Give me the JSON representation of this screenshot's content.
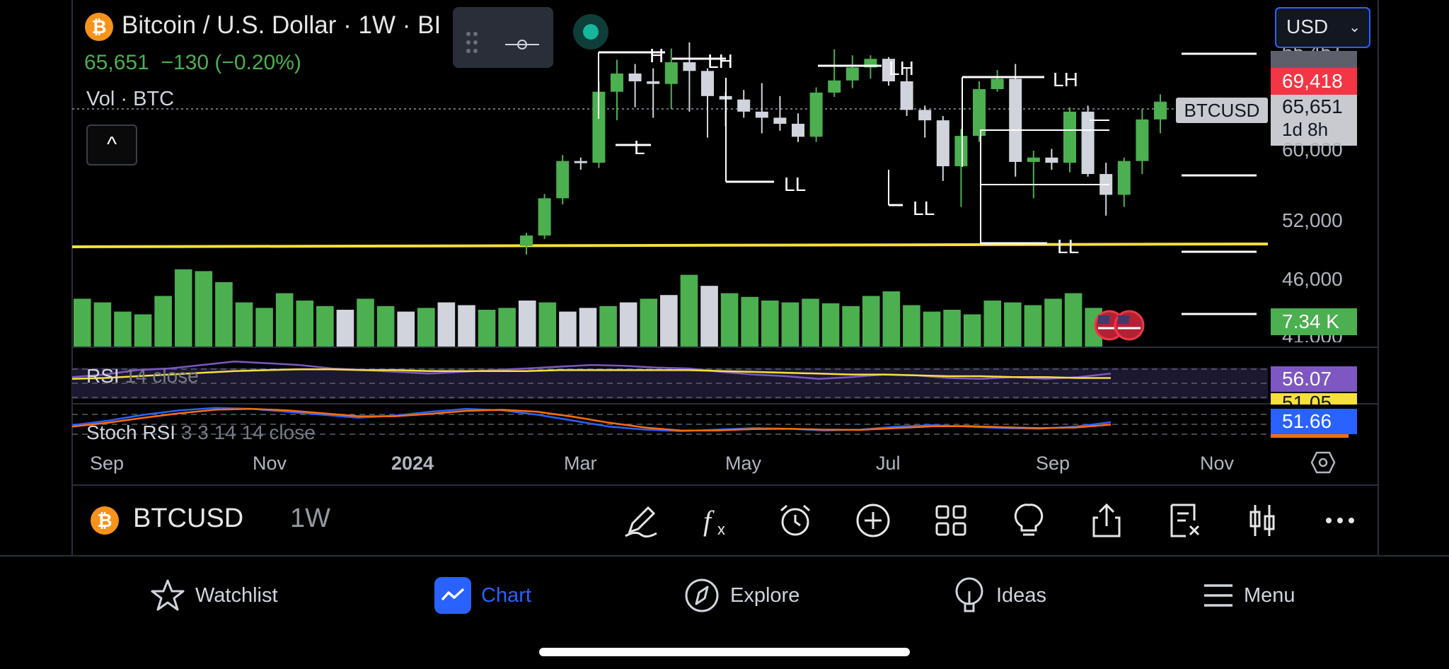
{
  "header": {
    "title": "Bitcoin / U.S. Dollar · 1W · BI",
    "coin_glyph": "₿",
    "price": "65,651",
    "change": "−130 (−0.20%)",
    "volume_label": "Vol · BTC",
    "collapse_glyph": "^"
  },
  "currency_select": {
    "value": "USD"
  },
  "price_axis": {
    "ticks": [
      "60,000",
      "52,000",
      "46,000",
      "41,000"
    ],
    "partial_top": "65,451"
  },
  "badges": {
    "high": {
      "label": "69,418",
      "color": "#f23645"
    },
    "last": {
      "symbol": "BTCUSD",
      "price": "65,651",
      "countdown": "1d 8h"
    },
    "volume": {
      "label": "7.34 K",
      "color": "#4caf50"
    },
    "rsi": {
      "label": "56.07",
      "color": "#7e57c2"
    },
    "rsi_ma": {
      "label": "51.05",
      "color": "#f7e03b"
    },
    "stoch": {
      "label": "51.66",
      "color": "#2962ff"
    }
  },
  "annotations": {
    "swing_labels": [
      "H",
      "L",
      "LH",
      "LL",
      "LH",
      "LL",
      "LH",
      "LL"
    ]
  },
  "indicators": {
    "rsi": {
      "name": "RSI",
      "params": "14 close"
    },
    "stoch": {
      "name": "Stoch RSI",
      "params": "3 3 14 14 close"
    }
  },
  "time_axis": {
    "ticks": [
      "Sep",
      "Nov",
      "2024",
      "Mar",
      "May",
      "Jul",
      "Sep",
      "Nov"
    ]
  },
  "toolbar": {
    "symbol": "BTCUSD",
    "timeframe": "1W",
    "tools": [
      "pencil-icon",
      "function-icon",
      "alarm-icon",
      "plus-circle-icon",
      "grid-icon",
      "lightbulb-icon",
      "share-icon",
      "note-icon",
      "candle-icon",
      "more-icon"
    ]
  },
  "bottom_nav": {
    "items": [
      {
        "label": "Watchlist",
        "icon": "star-icon"
      },
      {
        "label": "Chart",
        "icon": "chart-icon",
        "active": true
      },
      {
        "label": "Explore",
        "icon": "compass-icon"
      },
      {
        "label": "Ideas",
        "icon": "bulb-icon"
      },
      {
        "label": "Menu",
        "icon": "menu-icon"
      }
    ]
  },
  "colors": {
    "up": "#4caf50",
    "down": "#d1d4dc",
    "support_line": "#f7e03b",
    "accent": "#2962ff",
    "rsi_line": "#7e57c2",
    "stoch_k": "#2962ff",
    "stoch_d": "#ff6d00"
  },
  "chart_data": {
    "type": "candlestick",
    "interval": "1W",
    "price_axis_ticks": [
      41000,
      46000,
      52000,
      60000
    ],
    "support_level": 48900,
    "candles": [
      {
        "o": 49000,
        "h": 50500,
        "l": 48000,
        "c": 50200
      },
      {
        "o": 50200,
        "h": 55000,
        "l": 49800,
        "c": 54500
      },
      {
        "o": 54500,
        "h": 59500,
        "l": 53800,
        "c": 58800
      },
      {
        "o": 58800,
        "h": 59200,
        "l": 57800,
        "c": 58600
      },
      {
        "o": 58600,
        "h": 68000,
        "l": 58000,
        "c": 66800
      },
      {
        "o": 66800,
        "h": 70500,
        "l": 63500,
        "c": 68900
      },
      {
        "o": 68900,
        "h": 70000,
        "l": 65000,
        "c": 68000
      },
      {
        "o": 68000,
        "h": 69500,
        "l": 63800,
        "c": 67700
      },
      {
        "o": 67700,
        "h": 71800,
        "l": 64800,
        "c": 70200
      },
      {
        "o": 70200,
        "h": 72500,
        "l": 64500,
        "c": 69200
      },
      {
        "o": 69200,
        "h": 69500,
        "l": 61500,
        "c": 66300
      },
      {
        "o": 66300,
        "h": 66800,
        "l": 62800,
        "c": 65900
      },
      {
        "o": 65900,
        "h": 67000,
        "l": 63800,
        "c": 64500
      },
      {
        "o": 64500,
        "h": 67800,
        "l": 62000,
        "c": 63800
      },
      {
        "o": 63800,
        "h": 66300,
        "l": 62300,
        "c": 63100
      },
      {
        "o": 63100,
        "h": 64300,
        "l": 61000,
        "c": 61600
      },
      {
        "o": 61600,
        "h": 67300,
        "l": 61000,
        "c": 66700
      },
      {
        "o": 66700,
        "h": 71700,
        "l": 66200,
        "c": 68100
      },
      {
        "o": 68100,
        "h": 71000,
        "l": 67200,
        "c": 69600
      },
      {
        "o": 69600,
        "h": 71000,
        "l": 68300,
        "c": 70600
      },
      {
        "o": 70600,
        "h": 70800,
        "l": 67500,
        "c": 68000
      },
      {
        "o": 68000,
        "h": 69500,
        "l": 64000,
        "c": 64700
      },
      {
        "o": 64700,
        "h": 65200,
        "l": 61500,
        "c": 63500
      },
      {
        "o": 63500,
        "h": 64000,
        "l": 56500,
        "c": 58200
      },
      {
        "o": 58200,
        "h": 62500,
        "l": 53500,
        "c": 61700
      },
      {
        "o": 61700,
        "h": 68000,
        "l": 61000,
        "c": 67100
      },
      {
        "o": 67100,
        "h": 69300,
        "l": 66800,
        "c": 68300
      },
      {
        "o": 68300,
        "h": 70000,
        "l": 57000,
        "c": 58700
      },
      {
        "o": 58700,
        "h": 60000,
        "l": 54500,
        "c": 59200
      },
      {
        "o": 59200,
        "h": 60200,
        "l": 57800,
        "c": 58600
      },
      {
        "o": 58600,
        "h": 65000,
        "l": 57500,
        "c": 64500
      },
      {
        "o": 64500,
        "h": 65200,
        "l": 57000,
        "c": 57300
      },
      {
        "o": 57300,
        "h": 58600,
        "l": 52500,
        "c": 54900
      },
      {
        "o": 54900,
        "h": 59200,
        "l": 53500,
        "c": 58800
      },
      {
        "o": 58800,
        "h": 64800,
        "l": 57300,
        "c": 63600
      },
      {
        "o": 63600,
        "h": 66500,
        "l": 62000,
        "c": 65651
      }
    ],
    "volume_bars": [
      52,
      48,
      38,
      35,
      55,
      84,
      82,
      70,
      48,
      42,
      58,
      50,
      44,
      40,
      52,
      44,
      38,
      42,
      48,
      45,
      40,
      42,
      50,
      48,
      38,
      42,
      44,
      48,
      52,
      56,
      78,
      66,
      58,
      54,
      50,
      48,
      52,
      47,
      44,
      55,
      60,
      45,
      38,
      40,
      35,
      50,
      48,
      45,
      52,
      58,
      42
    ],
    "rsi": [
      52,
      55,
      60,
      62,
      66,
      70,
      68,
      66,
      62,
      60,
      58,
      56,
      58,
      60,
      62,
      64,
      66,
      65,
      63,
      62,
      58,
      55,
      53,
      50,
      52,
      55,
      54,
      51,
      50,
      52,
      50,
      52,
      56
    ],
    "rsi_ma": [
      50,
      51,
      53,
      55,
      57,
      59,
      60,
      61,
      61,
      60,
      60,
      59,
      59,
      59,
      59,
      60,
      60,
      60,
      60,
      60,
      59,
      58,
      57,
      56,
      55,
      55,
      54,
      53,
      53,
      52,
      52,
      51,
      51
    ],
    "stoch_k": [
      40,
      55,
      75,
      90,
      98,
      95,
      85,
      75,
      65,
      72,
      85,
      95,
      90,
      75,
      55,
      35,
      25,
      20,
      25,
      30,
      28,
      22,
      25,
      35,
      40,
      35,
      30,
      28,
      35,
      50
    ],
    "stoch_d": [
      35,
      48,
      65,
      80,
      92,
      95,
      90,
      80,
      70,
      70,
      78,
      88,
      92,
      85,
      68,
      48,
      32,
      22,
      22,
      27,
      28,
      25,
      24,
      30,
      36,
      37,
      33,
      30,
      32,
      42
    ]
  }
}
